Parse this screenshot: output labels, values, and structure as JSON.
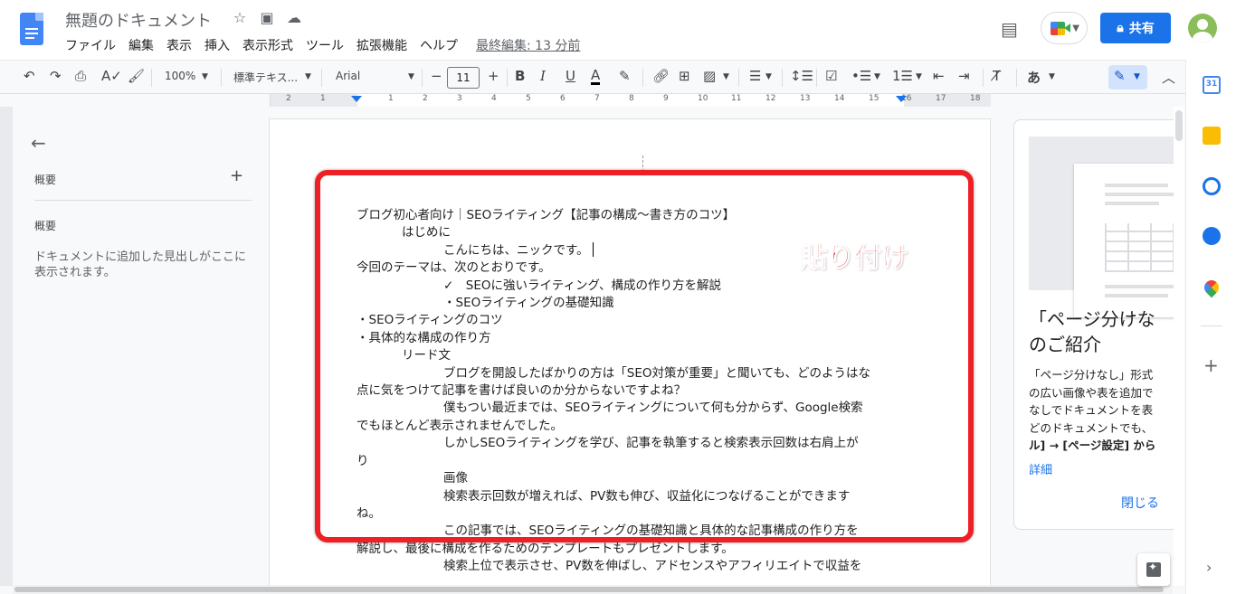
{
  "header": {
    "doc_title": "無題のドキュメント",
    "menu": [
      "ファイル",
      "編集",
      "表示",
      "挿入",
      "表示形式",
      "ツール",
      "拡張機能",
      "ヘルプ"
    ],
    "last_edit": "最終編集: 13 分前",
    "share_label": "共有"
  },
  "toolbar": {
    "zoom": "100%",
    "style": "標準テキス...",
    "font": "Arial",
    "font_size": "11",
    "input_method": "あ"
  },
  "ruler": {
    "numbers": [
      "2",
      "1",
      "",
      "1",
      "2",
      "3",
      "4",
      "5",
      "6",
      "7",
      "8",
      "9",
      "10",
      "11",
      "12",
      "13",
      "14",
      "15",
      "16",
      "17",
      "18"
    ]
  },
  "outline": {
    "summary_label": "概要",
    "outline_label": "概要",
    "hint": "ドキュメントに追加した見出しがここに表示されます。"
  },
  "document": {
    "lines": [
      {
        "text": "ブログ初心者向け｜SEOライティング【記事の構成～書き方のコツ】",
        "indent": 0
      },
      {
        "text": "はじめに",
        "indent": 1
      },
      {
        "text": "こんにちは、ニックです。",
        "indent": 2,
        "cursor": true
      },
      {
        "text": "今回のテーマは、次のとおりです。",
        "indent": 0
      },
      {
        "text": "✓　SEOに強いライティング、構成の作り方を解説",
        "indent": 2
      },
      {
        "text": "・SEOライティングの基礎知識",
        "indent": 2
      },
      {
        "text": "・SEOライティングのコツ",
        "indent": 0
      },
      {
        "text": "・具体的な構成の作り方",
        "indent": 0
      },
      {
        "text": "リード文",
        "indent": 1
      },
      {
        "text": "ブログを開設したばかりの方は「SEO対策が重要」と聞いても、どのようはな",
        "indent": 2
      },
      {
        "text": "点に気をつけて記事を書けば良いのか分からないですよね？",
        "indent": 0
      },
      {
        "text": "僕もつい最近までは、SEOライティングについて何も分からず、Google検索",
        "indent": 2
      },
      {
        "text": "でもほとんど表示されませんでした。",
        "indent": 0
      },
      {
        "text": "しかしSEOライティングを学び、記事を執筆すると検索表示回数は右肩上が",
        "indent": 2
      },
      {
        "text": "り",
        "indent": 0
      },
      {
        "text": "画像",
        "indent": 2
      },
      {
        "text": "検索表示回数が増えれば、PV数も伸び、収益化につなげることができます",
        "indent": 2
      },
      {
        "text": "ね。",
        "indent": 0
      },
      {
        "text": "この記事では、SEOライティングの基礎知識と具体的な記事構成の作り方を",
        "indent": 2
      },
      {
        "text": "解説し、最後に構成を作るためのテンプレートもプレゼントします。",
        "indent": 0
      },
      {
        "text": "検索上位で表示させ、PV数を伸ばし、アドセンスやアフィリエイトで収益を",
        "indent": 2
      }
    ],
    "callout": "貼り付け"
  },
  "promo": {
    "title_line1": "「ページ分けな",
    "title_line2": "のご紹介",
    "body_line1": "「ページ分けなし」形式",
    "body_line2": "の広い画像や表を追加で",
    "body_line3": "なしでドキュメントを表",
    "body_line4": "どのドキュメントでも、",
    "body_line5": "ル] → [ページ設定] から",
    "details_link": "詳細",
    "close_label": "閉じる"
  },
  "sidepanel": {
    "calendar_day": "31"
  },
  "colors": {
    "accent": "#1a73e8",
    "callout_red": "#ee1f25"
  }
}
